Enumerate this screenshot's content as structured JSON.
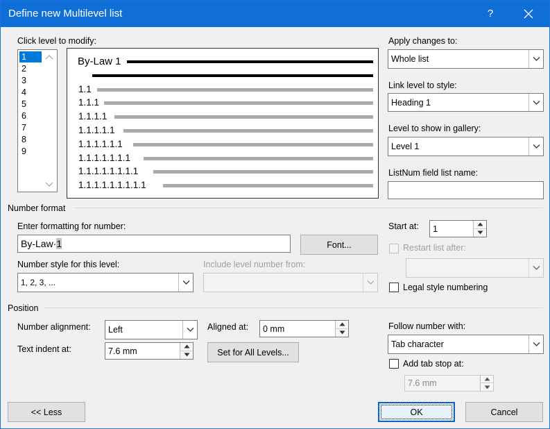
{
  "window": {
    "title": "Define new Multilevel list",
    "help_glyph": "?"
  },
  "levels_section": {
    "label": "Click level to modify:",
    "items": [
      "1",
      "2",
      "3",
      "4",
      "5",
      "6",
      "7",
      "8",
      "9"
    ],
    "selected": "1"
  },
  "preview": {
    "level1_text": "By-Law 1",
    "numbers": [
      "1.1",
      "1.1.1",
      "1.1.1.1",
      "1.1.1.1.1",
      "1.1.1.1.1.1",
      "1.1.1.1.1.1.1",
      "1.1.1.1.1.1.1.1",
      "1.1.1.1.1.1.1.1.1"
    ]
  },
  "right_panel": {
    "apply_changes_label": "Apply changes to:",
    "apply_changes_value": "Whole list",
    "link_level_label": "Link level to style:",
    "link_level_value": "Heading 1",
    "gallery_label": "Level to show in gallery:",
    "gallery_value": "Level 1",
    "listnum_label": "ListNum field list name:",
    "listnum_value": ""
  },
  "number_format": {
    "header": "Number format",
    "enter_formatting_label": "Enter formatting for number:",
    "formatting_prefix": "By-Law·",
    "formatting_field_code": "1",
    "font_button": "Font...",
    "number_style_label": "Number style for this level:",
    "number_style_value": "1, 2, 3, ...",
    "include_level_label": "Include level number from:",
    "include_level_value": "",
    "start_at_label": "Start at:",
    "start_at_value": "1",
    "restart_label": "Restart list after:",
    "restart_value": "",
    "restart_checked": false,
    "legal_label": "Legal style numbering",
    "legal_checked": false
  },
  "position": {
    "header": "Position",
    "number_alignment_label": "Number alignment:",
    "number_alignment_value": "Left",
    "aligned_at_label": "Aligned at:",
    "aligned_at_value": "0 mm",
    "text_indent_label": "Text indent at:",
    "text_indent_value": "7.6 mm",
    "set_all_button": "Set for All Levels...",
    "follow_label": "Follow number with:",
    "follow_value": "Tab character",
    "add_tab_label": "Add tab stop at:",
    "add_tab_checked": false,
    "add_tab_value": "7.6 mm"
  },
  "footer": {
    "less_button": "<< Less",
    "ok_button": "OK",
    "cancel_button": "Cancel"
  },
  "colors": {
    "titlebar": "#0f6fd6",
    "selection": "#0078d7",
    "dialog_bg": "#f0f0f0"
  }
}
